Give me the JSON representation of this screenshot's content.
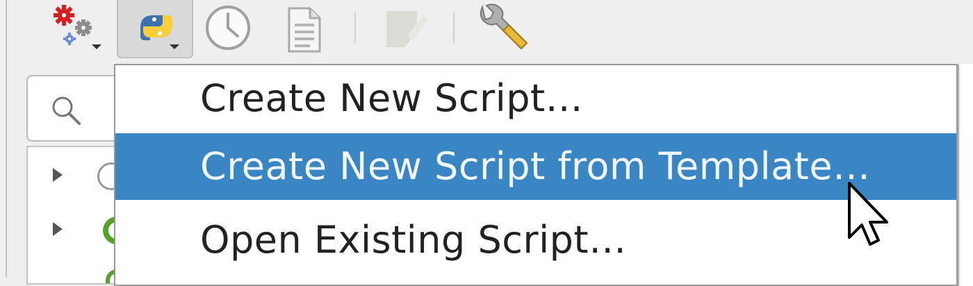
{
  "toolbar": {
    "buttons": [
      {
        "icon": "processing-gears-icon"
      },
      {
        "icon": "python-icon",
        "pressed": true
      },
      {
        "icon": "history-clock-icon"
      },
      {
        "icon": "results-document-icon"
      },
      {
        "icon": "edit-features-icon"
      },
      {
        "icon": "options-wrench-icon"
      }
    ]
  },
  "search": {
    "icon": "search-icon"
  },
  "menu": {
    "items": [
      {
        "label": "Create New Script…",
        "selected": false
      },
      {
        "label": "Create New Script from Template…",
        "selected": true
      },
      {
        "label": "Open Existing Script…",
        "selected": false
      }
    ]
  },
  "colors": {
    "selection": "#3a86c4",
    "background": "#efefef"
  }
}
